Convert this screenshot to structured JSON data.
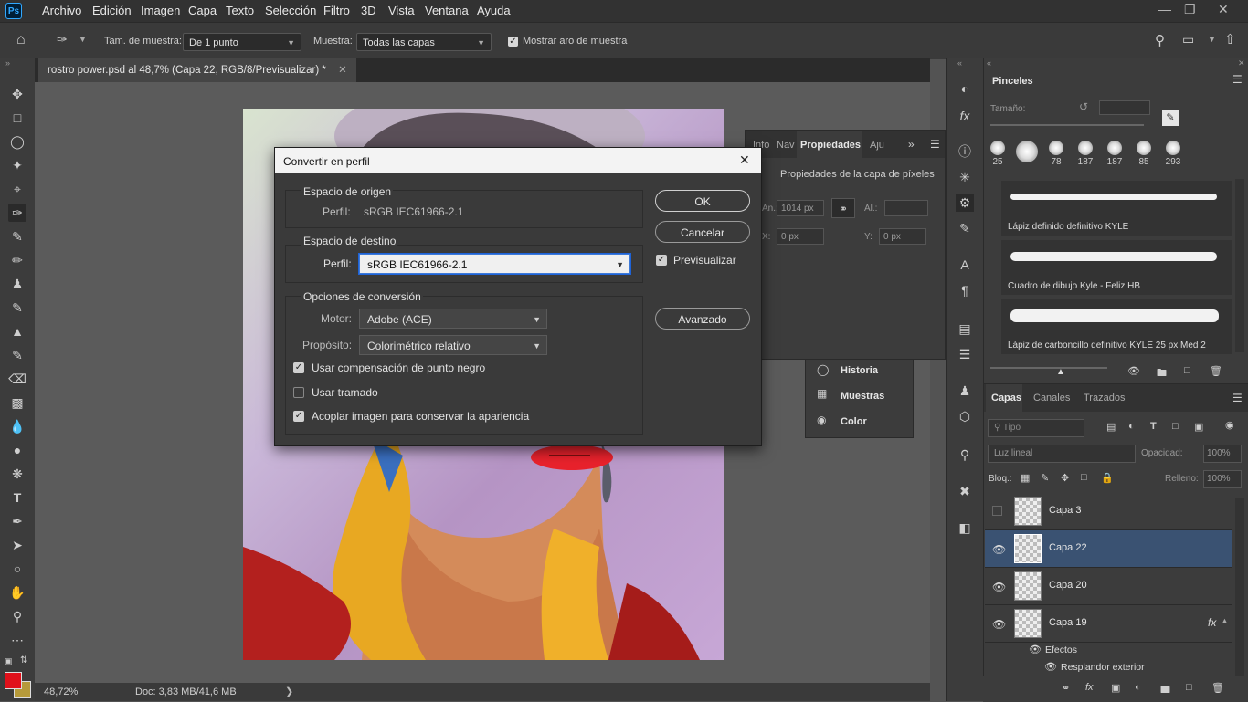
{
  "menu": {
    "logo": "Ps",
    "items": [
      "Archivo",
      "Edición",
      "Imagen",
      "Capa",
      "Texto",
      "Selección",
      "Filtro",
      "3D",
      "Vista",
      "Ventana",
      "Ayuda"
    ]
  },
  "options_bar": {
    "sample_size_label": "Tam. de muestra:",
    "sample_size_value": "De 1 punto",
    "sample_label": "Muestra:",
    "sample_value": "Todas las capas",
    "show_ring_label": "Mostrar aro de muestra"
  },
  "document": {
    "tab_title": "rostro power.psd al 48,7% (Capa 22, RGB/8/Previsualizar) *",
    "zoom": "48,72%",
    "doc_info": "Doc: 3,83 MB/41,6 MB"
  },
  "dialog": {
    "title": "Convertir en perfil",
    "source_group": "Espacio de origen",
    "source_profile_label": "Perfil:",
    "source_profile_value": "sRGB IEC61966-2.1",
    "dest_group": "Espacio de destino",
    "dest_profile_label": "Perfil:",
    "dest_profile_value": "sRGB IEC61966-2.1",
    "conversion_group": "Opciones de conversión",
    "engine_label": "Motor:",
    "engine_value": "Adobe (ACE)",
    "intent_label": "Propósito:",
    "intent_value": "Colorimétrico relativo",
    "black_point_label": "Usar compensación de punto negro",
    "dither_label": "Usar tramado",
    "flatten_label": "Acoplar imagen para conservar la apariencia",
    "ok": "OK",
    "cancel": "Cancelar",
    "preview": "Previsualizar",
    "advanced": "Avanzado"
  },
  "properties_panel": {
    "tabs": [
      "Info",
      "Nav",
      "Propiedades",
      "Aju"
    ],
    "subtitle": "Propiedades de la capa de píxeles",
    "w_label": "An.:",
    "w_value": "1014 px",
    "h_label": "Al.:",
    "x_label": "X:",
    "x_value": "0 px",
    "y_label": "Y:",
    "y_value": "0 px"
  },
  "history_panel": {
    "items": [
      "Historia",
      "Muestras",
      "Color"
    ]
  },
  "brushes_panel": {
    "title": "Pinceles",
    "size_label": "Tamaño:",
    "tip_sizes": [
      "25",
      "",
      "78",
      "187",
      "187",
      "85",
      "293"
    ],
    "brushes": [
      "Lápiz definido definitivo KYLE",
      "Cuadro de dibujo Kyle - Feliz HB",
      "Lápiz de carboncillo definitivo KYLE 25 px Med 2"
    ]
  },
  "layers_panel": {
    "tabs": [
      "Capas",
      "Canales",
      "Trazados"
    ],
    "filter_placeholder": "Tipo",
    "blend_mode": "Luz lineal",
    "opacity_label": "Opacidad:",
    "opacity_value": "100%",
    "lock_label": "Bloq.:",
    "fill_label": "Relleno:",
    "fill_value": "100%",
    "layers": [
      "Capa 3",
      "Capa 22",
      "Capa 20",
      "Capa 19"
    ],
    "effects_label": "Efectos",
    "effect_item": "Resplandor exterior",
    "fx_badge": "fx"
  },
  "colors": {
    "foreground": "#e0101a",
    "background": "#b69a3a",
    "accent": "#31a8ff"
  }
}
